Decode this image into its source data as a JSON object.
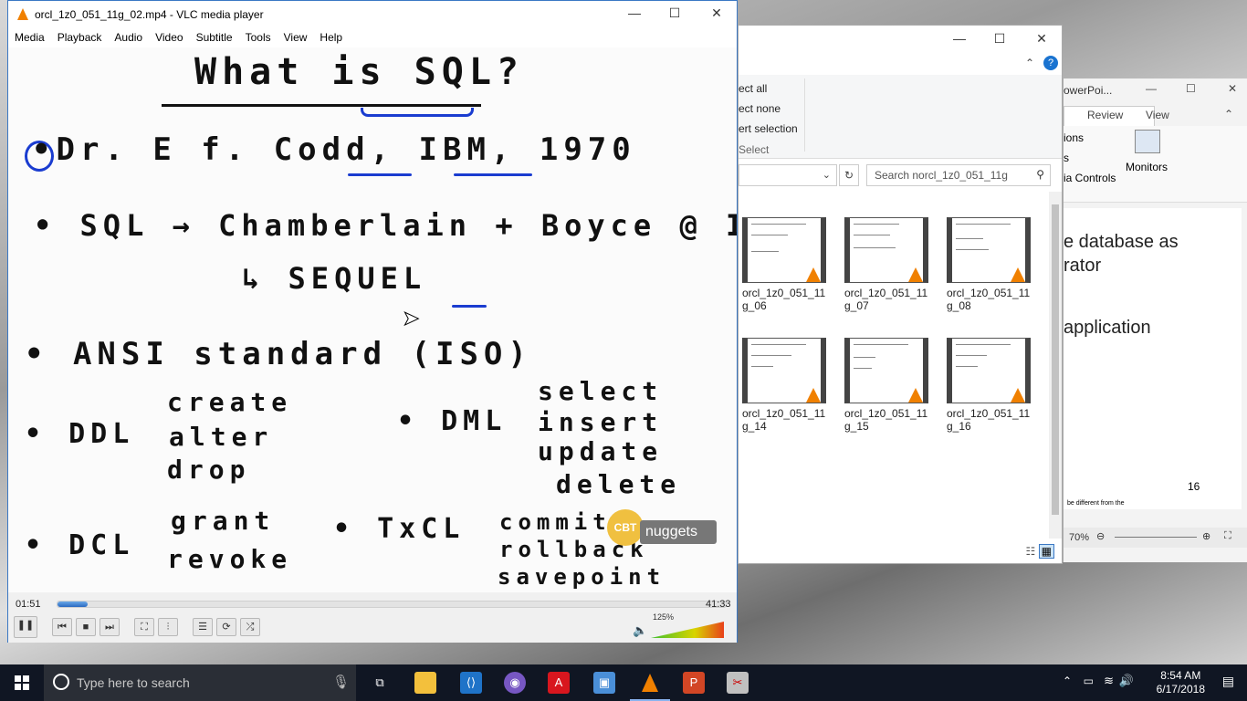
{
  "vlc": {
    "title": "orcl_1z0_051_11g_02.mp4 - VLC media player",
    "menu": [
      "Media",
      "Playback",
      "Audio",
      "Video",
      "Subtitle",
      "Tools",
      "View",
      "Help"
    ],
    "elapsed": "01:51",
    "duration": "41:33",
    "progress": 0.045,
    "volume": "125%",
    "video_text": {
      "title": "What is SQL?",
      "line1": "•Dr. E f. Codd, IBM, 1970",
      "line2": "• SQL → Chamberlain + Boyce @ IBM",
      "line3": "↳ SEQUEL",
      "line4": "• ANSI standard (ISO)",
      "ddl": "• DDL",
      "ddl_items": [
        "create",
        "alter",
        "drop"
      ],
      "dml": "• DML",
      "dml_items": [
        "select",
        "insert",
        "update",
        "delete"
      ],
      "dcl": "• DCL",
      "dcl_items": [
        "grant",
        "revoke"
      ],
      "txcl": "• TxCL",
      "txcl_items": [
        "commit",
        "rollback",
        "savepoint"
      ],
      "logo_a": "CBT",
      "logo_b": "nuggets"
    }
  },
  "explorer": {
    "ribbon_items": [
      "ect all",
      "ect none",
      "ert selection",
      "Select"
    ],
    "search_placeholder": "Search norcl_1z0_051_11g",
    "files": [
      {
        "name": "orcl_1z0_051_11g_06"
      },
      {
        "name": "orcl_1z0_051_11g_07"
      },
      {
        "name": "orcl_1z0_051_11g_08"
      },
      {
        "name": "orcl_1z0_051_11g_14"
      },
      {
        "name": "orcl_1z0_051_11g_15"
      },
      {
        "name": "orcl_1z0_051_11g_16"
      }
    ]
  },
  "ppt": {
    "title": "owerPoi...",
    "tabs": [
      "Review",
      "View"
    ],
    "ribbon": [
      "ions",
      "s",
      "ia Controls"
    ],
    "monitors": "Monitors",
    "slide_lines": [
      "e database as",
      "rator",
      "application"
    ],
    "slide_number": "16",
    "footnote": "be different from the",
    "zoom": "70%"
  },
  "taskbar": {
    "search_placeholder": "Type here to search",
    "time": "8:54 AM",
    "date": "6/17/2018"
  }
}
